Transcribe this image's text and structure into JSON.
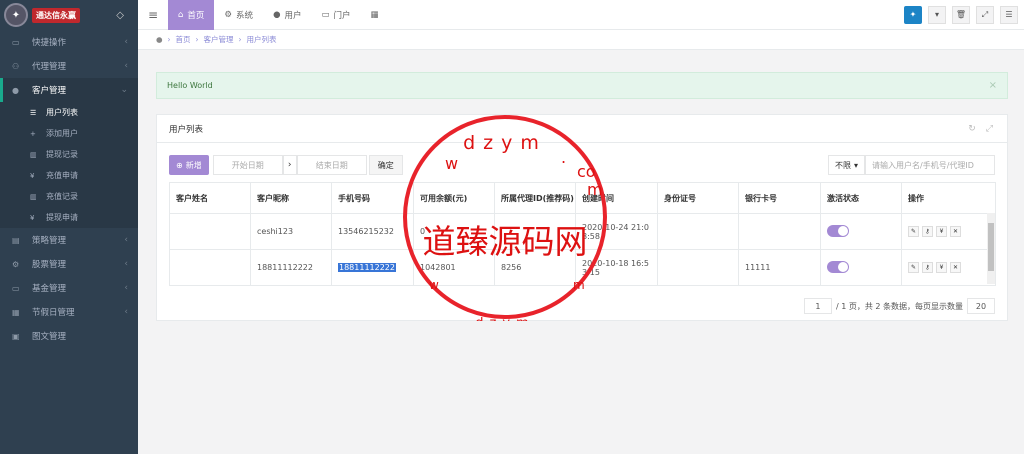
{
  "logo": {
    "text": "通达信永赢",
    "drop_icon": "droplet-icon"
  },
  "sidebar": {
    "items": [
      {
        "label": "快捷操作",
        "icon": "folder-icon"
      },
      {
        "label": "代理管理",
        "icon": "users-icon"
      },
      {
        "label": "客户管理",
        "icon": "user-icon"
      },
      {
        "label": "策略管理",
        "icon": "strategy-icon"
      },
      {
        "label": "股票管理",
        "icon": "stock-icon"
      },
      {
        "label": "基金管理",
        "icon": "fund-icon"
      },
      {
        "label": "节假日管理",
        "icon": "calendar-icon"
      },
      {
        "label": "图文管理",
        "icon": "image-icon"
      }
    ],
    "sub": [
      {
        "label": "用户列表"
      },
      {
        "label": "添加用户"
      },
      {
        "label": "提现记录"
      },
      {
        "label": "充值申请"
      },
      {
        "label": "充值记录"
      },
      {
        "label": "提现申请"
      }
    ]
  },
  "topbar": {
    "tabs": [
      {
        "label": "首页"
      },
      {
        "label": "系统"
      },
      {
        "label": "用户"
      },
      {
        "label": "门户"
      }
    ]
  },
  "breadcrumb": {
    "home": "首页",
    "mid": "客户管理",
    "current": "用户列表"
  },
  "alert": {
    "text": "Hello World"
  },
  "panel": {
    "title": "用户列表"
  },
  "filter": {
    "new_label": "新增",
    "start": "开始日期",
    "end": "结束日期",
    "ok": "确定",
    "select": "不限",
    "search_placeholder": "请输入用户名/手机号/代理ID"
  },
  "table": {
    "headers": [
      "客户姓名",
      "客户昵称",
      "手机号码",
      "可用余额(元)",
      "所属代理ID(推荐码)",
      "创建时间",
      "身份证号",
      "银行卡号",
      "激活状态",
      "操作"
    ],
    "rows": [
      {
        "name": "",
        "nick": "ceshi123",
        "phone": "13546215232",
        "balance": "0",
        "agent": "",
        "created": "2020-10-24 21:0 8:58",
        "idcard": "",
        "bank": ""
      },
      {
        "name": "",
        "nick": "18811112222",
        "phone": "18811112222",
        "balance": "1042801",
        "agent": "8256",
        "created": "2020-10-18 16:5 3:15",
        "idcard": "",
        "bank": "11111"
      }
    ]
  },
  "pager": {
    "page": "1",
    "total_text": "/ 1 页，共 2 条数据，每页显示数量",
    "size": "20"
  },
  "stamp": {
    "top": "dzym",
    "mid": "道臻源码网",
    "bottom": "dzym",
    "w": "w",
    "dot": ".",
    "co": "co",
    "m": "m"
  }
}
